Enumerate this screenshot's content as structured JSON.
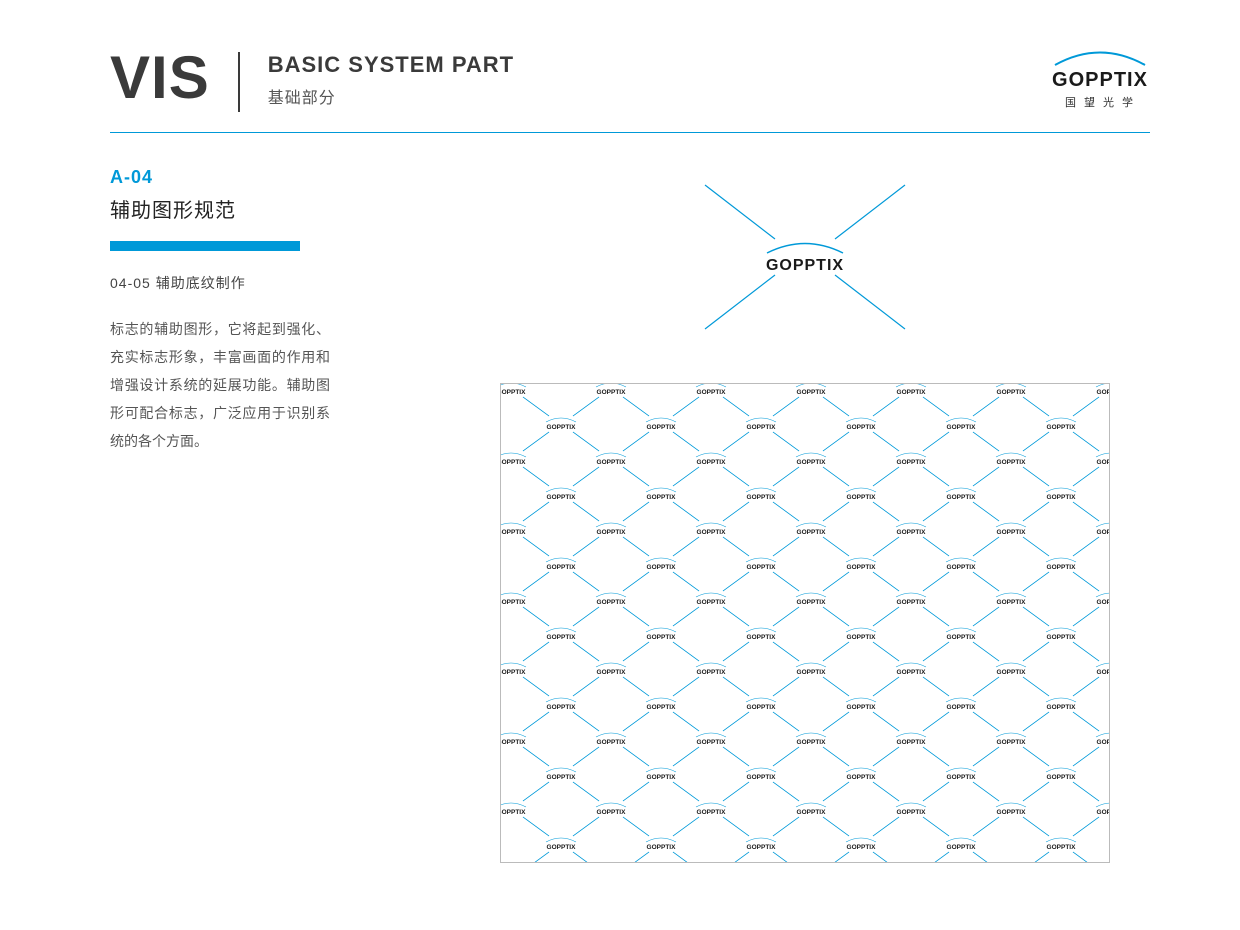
{
  "header": {
    "vis": "VIS",
    "subtitle_en": "BASIC SYSTEM PART",
    "subtitle_cn": "基础部分"
  },
  "brand": {
    "name": "GOPPTIX",
    "name_cn": "国望光学"
  },
  "section": {
    "code": "A-04",
    "title": "辅助图形规范",
    "sub_number": "04-05  辅助底纹制作",
    "body": "标志的辅助图形，它将起到强化、充实标志形象，丰富画面的作用和增强设计系统的延展功能。辅助图形可配合标志，广泛应用于识别系统的各个方面。"
  },
  "colors": {
    "accent": "#0099d8",
    "text_dark": "#3a3a3a"
  }
}
